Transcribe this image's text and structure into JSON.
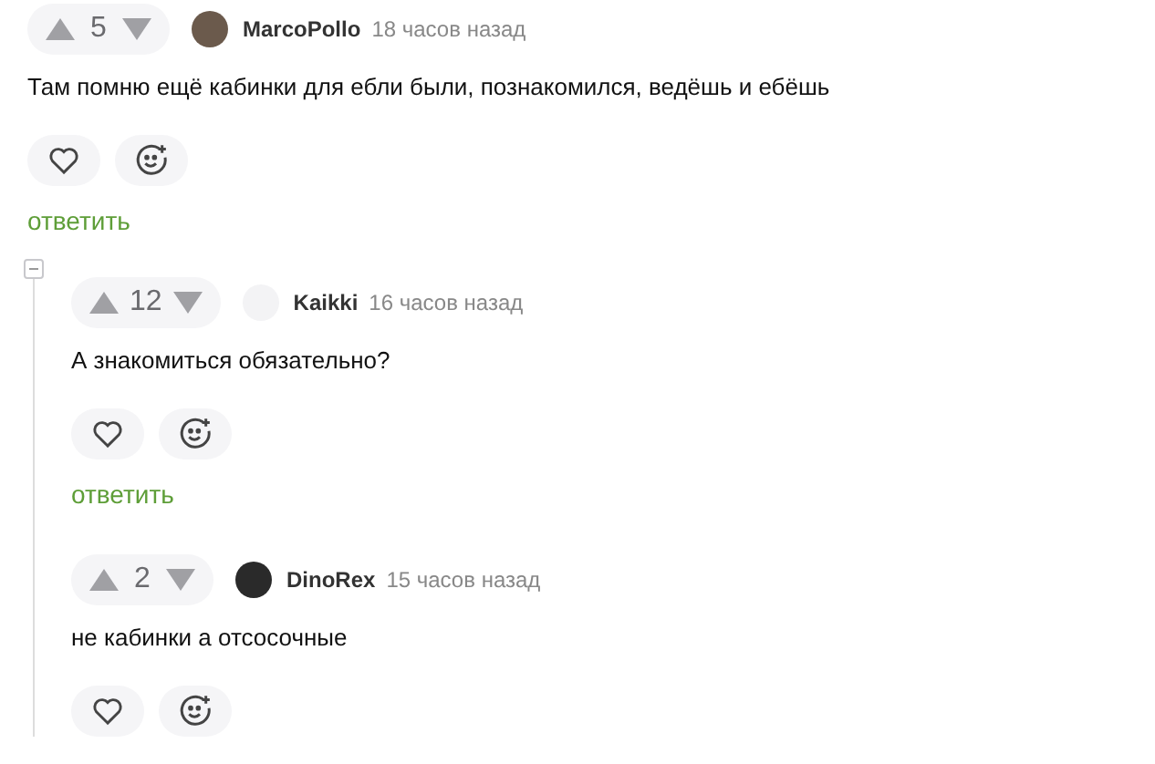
{
  "comments": [
    {
      "votes": "5",
      "author": "MarcoPollo",
      "color": "#6b5a4c",
      "time": "18 часов назад",
      "text": "Там помню ещё кабинки для ебли были, познакомился, ведёшь и ебёшь",
      "reply": "ответить",
      "thread_expanded": true,
      "children": [
        {
          "votes": "12",
          "author": "Kaikki",
          "color": "#f3f3f5",
          "time": "16 часов назад",
          "text": "А знакомиться обязательно?",
          "reply": "ответить"
        },
        {
          "votes": "2",
          "author": "DinoRex",
          "color": "#2a2a2a",
          "time": "15 часов назад",
          "text": "не кабинки а отсосочные"
        }
      ]
    }
  ]
}
